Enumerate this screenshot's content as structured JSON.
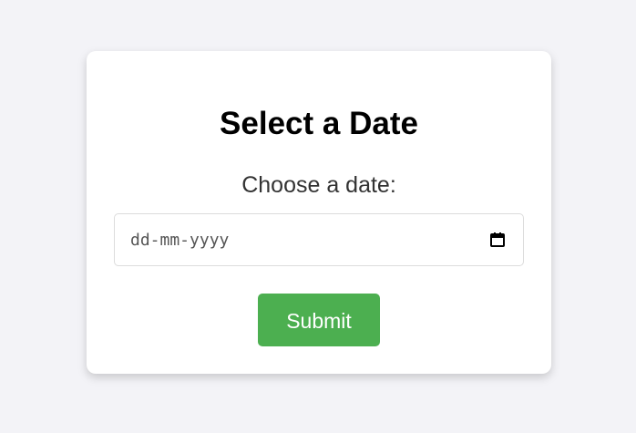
{
  "form": {
    "title": "Select a Date",
    "date_label": "Choose a date:",
    "date_placeholder": "dd-mm-yyyy",
    "date_value": "",
    "submit_label": "Submit",
    "calendar_icon": "calendar-icon"
  },
  "colors": {
    "page_background": "#f3f3f7",
    "card_background": "#ffffff",
    "submit_background": "#4caf50",
    "submit_text": "#ffffff",
    "title_text": "#000000",
    "label_text": "#333333"
  }
}
